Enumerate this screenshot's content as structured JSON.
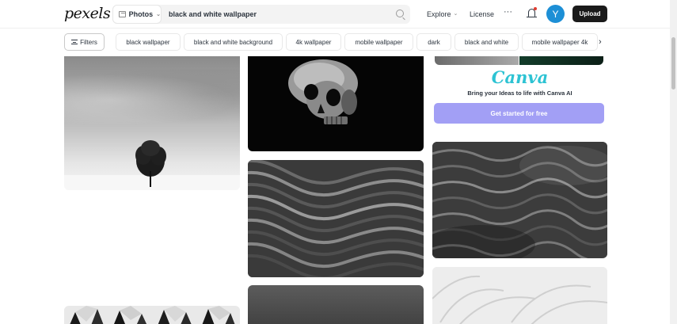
{
  "header": {
    "logo_text": "pexels",
    "search": {
      "type_label": "Photos",
      "query": "black and white wallpaper"
    },
    "nav": {
      "explore_label": "Explore",
      "license_label": "License",
      "more_label": "···"
    },
    "avatar_initial": "Y",
    "upload_label": "Upload"
  },
  "chips": {
    "filters_label": "Filters",
    "items": [
      "black wallpaper",
      "black and white background",
      "4k wallpaper",
      "mobile wallpaper",
      "dark",
      "black and white",
      "mobile wallpaper 4k"
    ],
    "next_label": "›"
  },
  "ad": {
    "brand": "Canva",
    "tagline": "Bring your Ideas to life with Canva AI",
    "cta_label": "Get started for free",
    "cta_color": "#a29ff5",
    "brand_color": "#2dc3d3"
  },
  "photos": [
    {
      "subject": "lone tree in snow"
    },
    {
      "subject": "skull on black"
    },
    {
      "subject": "wavy dark lines"
    },
    {
      "subject": "dark sand"
    },
    {
      "subject": "geometric pattern"
    },
    {
      "subject": "rippled sand"
    },
    {
      "subject": "white texture"
    }
  ],
  "colors": {
    "accent": "#1d8fd6",
    "upload_bg": "#1a1a1a",
    "notification": "#e03c2f"
  }
}
